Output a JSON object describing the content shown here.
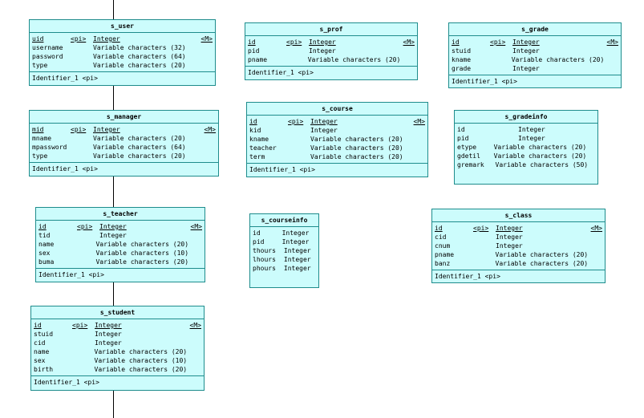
{
  "entities": {
    "s_user": {
      "title": "s_user",
      "rows": [
        {
          "name": "uid",
          "pi": "<pi>",
          "type": "Integer",
          "m": "<M>",
          "pk": true
        },
        {
          "name": "username",
          "pi": "",
          "type": "Variable characters (32)",
          "m": ""
        },
        {
          "name": "password",
          "pi": "",
          "type": "Variable characters (64)",
          "m": ""
        },
        {
          "name": "type",
          "pi": "",
          "type": "Variable characters (20)",
          "m": ""
        }
      ],
      "identifier": "Identifier_1  <pi>"
    },
    "s_prof": {
      "title": "s_prof",
      "rows": [
        {
          "name": "id",
          "pi": "<pi>",
          "type": "Integer",
          "m": "<M>",
          "pk": true
        },
        {
          "name": "pid",
          "pi": "",
          "type": "Integer",
          "m": ""
        },
        {
          "name": "pname",
          "pi": "",
          "type": "Variable characters (20)",
          "m": ""
        }
      ],
      "identifier": "Identifier_1  <pi>"
    },
    "s_grade": {
      "title": "s_grade",
      "rows": [
        {
          "name": "id",
          "pi": "<pi>",
          "type": "Integer",
          "m": "<M>",
          "pk": true
        },
        {
          "name": "stuid",
          "pi": "",
          "type": "Integer",
          "m": ""
        },
        {
          "name": "kname",
          "pi": "",
          "type": "Variable characters (20)",
          "m": ""
        },
        {
          "name": "grade",
          "pi": "",
          "type": "Integer",
          "m": ""
        }
      ],
      "identifier": "Identifier_1  <pi>"
    },
    "s_manager": {
      "title": "s_manager",
      "rows": [
        {
          "name": "mid",
          "pi": "<pi>",
          "type": "Integer",
          "m": "<M>",
          "pk": true
        },
        {
          "name": "mname",
          "pi": "",
          "type": "Variable characters (20)",
          "m": ""
        },
        {
          "name": "mpassword",
          "pi": "",
          "type": "Variable characters (64)",
          "m": ""
        },
        {
          "name": "type",
          "pi": "",
          "type": "Variable characters (20)",
          "m": ""
        }
      ],
      "identifier": "Identifier_1  <pi>"
    },
    "s_course": {
      "title": "s_course",
      "rows": [
        {
          "name": "id",
          "pi": "<pi>",
          "type": "Integer",
          "m": "<M>",
          "pk": true
        },
        {
          "name": "kid",
          "pi": "",
          "type": "Integer",
          "m": ""
        },
        {
          "name": "kname",
          "pi": "",
          "type": "Variable characters (20)",
          "m": ""
        },
        {
          "name": "teacher",
          "pi": "",
          "type": "Variable characters (20)",
          "m": ""
        },
        {
          "name": "term",
          "pi": "",
          "type": "Variable characters (20)",
          "m": ""
        }
      ],
      "identifier": "Identifier_1  <pi>"
    },
    "s_gradeinfo": {
      "title": "s_gradeinfo",
      "rows": [
        {
          "name": "id",
          "pi": "",
          "type": "Integer",
          "m": ""
        },
        {
          "name": "pid",
          "pi": "",
          "type": "Integer",
          "m": ""
        },
        {
          "name": "etype",
          "pi": "",
          "type": "Variable characters (20)",
          "m": ""
        },
        {
          "name": "gdetil",
          "pi": "",
          "type": "Variable characters (20)",
          "m": ""
        },
        {
          "name": "gremark",
          "pi": "",
          "type": "Variable characters (50)",
          "m": ""
        }
      ],
      "identifier": ""
    },
    "s_teacher": {
      "title": "s_teacher",
      "rows": [
        {
          "name": "id",
          "pi": "<pi>",
          "type": "Integer",
          "m": "<M>",
          "pk": true
        },
        {
          "name": "tid",
          "pi": "",
          "type": "Integer",
          "m": ""
        },
        {
          "name": "name",
          "pi": "",
          "type": "Variable characters (20)",
          "m": ""
        },
        {
          "name": "sex",
          "pi": "",
          "type": "Variable characters (10)",
          "m": ""
        },
        {
          "name": "buma",
          "pi": "",
          "type": "Variable characters (20)",
          "m": ""
        }
      ],
      "identifier": "Identifier_1  <pi>"
    },
    "s_courseinfo": {
      "title": "s_courseinfo",
      "rows": [
        {
          "name": "id",
          "pi": "",
          "type": "Integer",
          "m": ""
        },
        {
          "name": "pid",
          "pi": "",
          "type": "Integer",
          "m": ""
        },
        {
          "name": "thours",
          "pi": "",
          "type": "Integer",
          "m": ""
        },
        {
          "name": "lhours",
          "pi": "",
          "type": "Integer",
          "m": ""
        },
        {
          "name": "phours",
          "pi": "",
          "type": "Integer",
          "m": ""
        }
      ],
      "identifier": ""
    },
    "s_class": {
      "title": "s_class",
      "rows": [
        {
          "name": "id",
          "pi": "<pi>",
          "type": "Integer",
          "m": "<M>",
          "pk": true
        },
        {
          "name": "cid",
          "pi": "",
          "type": "Integer",
          "m": ""
        },
        {
          "name": "cnum",
          "pi": "",
          "type": "Integer",
          "m": ""
        },
        {
          "name": "pname",
          "pi": "",
          "type": "Variable characters (20)",
          "m": ""
        },
        {
          "name": "banz",
          "pi": "",
          "type": "Variable characters (20)",
          "m": ""
        }
      ],
      "identifier": "Identifier_1  <pi>"
    },
    "s_student": {
      "title": "s_student",
      "rows": [
        {
          "name": "id",
          "pi": "<pi>",
          "type": "Integer",
          "m": "<M>",
          "pk": true
        },
        {
          "name": "stuid",
          "pi": "",
          "type": "Integer",
          "m": ""
        },
        {
          "name": "cid",
          "pi": "",
          "type": "Integer",
          "m": ""
        },
        {
          "name": "name",
          "pi": "",
          "type": "Variable characters (20)",
          "m": ""
        },
        {
          "name": "sex",
          "pi": "",
          "type": "Variable characters (10)",
          "m": ""
        },
        {
          "name": "birth",
          "pi": "",
          "type": "Variable characters (20)",
          "m": ""
        }
      ],
      "identifier": "Identifier_1  <pi>"
    }
  }
}
